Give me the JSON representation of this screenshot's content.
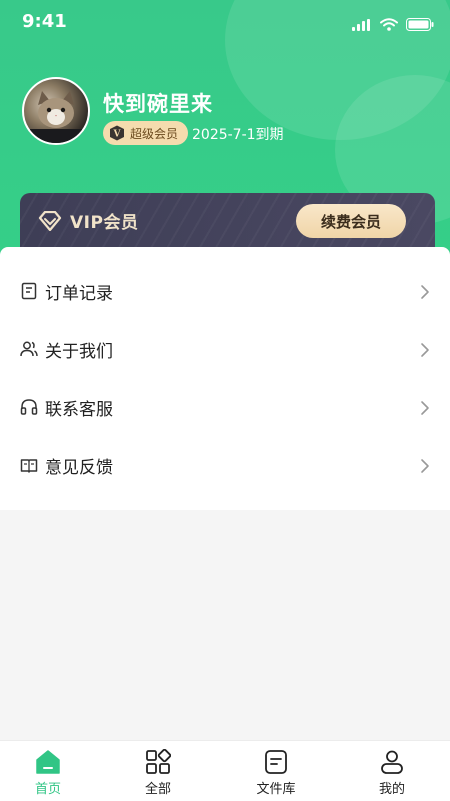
{
  "status_bar": {
    "time": "9:41"
  },
  "profile": {
    "username": "快到碗里来",
    "badge_label": "超级会员",
    "badge_letter": "V",
    "expiry": "2025-7-1到期"
  },
  "vip_card": {
    "title": "VIP会员",
    "renew_button": "续费会员"
  },
  "menu": {
    "items": [
      {
        "label": "订单记录",
        "icon": "document-icon"
      },
      {
        "label": "关于我们",
        "icon": "users-icon"
      },
      {
        "label": "联系客服",
        "icon": "headphones-icon"
      },
      {
        "label": "意见反馈",
        "icon": "book-icon"
      }
    ]
  },
  "tabbar": {
    "tabs": [
      {
        "label": "首页",
        "icon": "home-icon",
        "active": true
      },
      {
        "label": "全部",
        "icon": "grid-icon",
        "active": false
      },
      {
        "label": "文件库",
        "icon": "file-icon",
        "active": false
      },
      {
        "label": "我的",
        "icon": "user-icon",
        "active": false
      }
    ]
  },
  "colors": {
    "brand_green": "#35cf88",
    "vip_dark": "#44425c",
    "gold": "#f5dcae"
  }
}
